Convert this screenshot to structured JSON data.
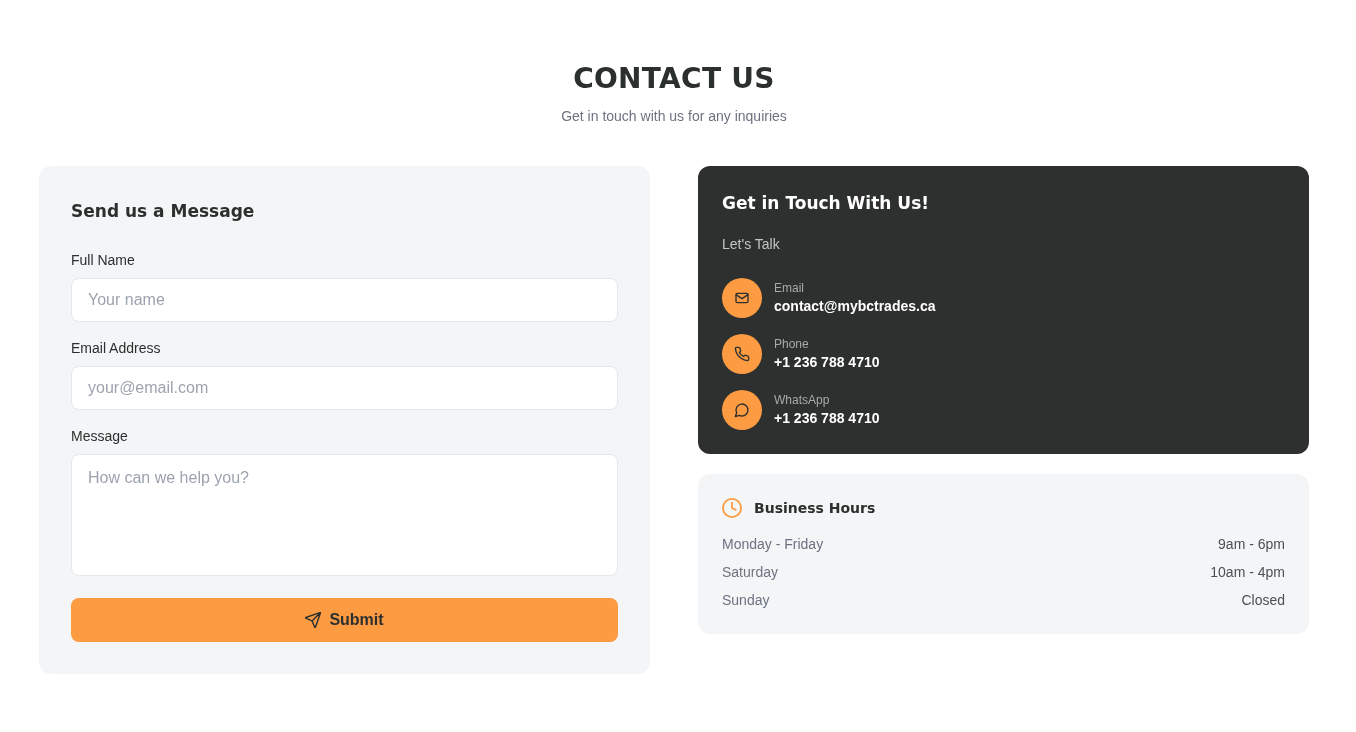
{
  "header": {
    "title": "CONTACT US",
    "subtitle": "Get in touch with us for any inquiries"
  },
  "form": {
    "title": "Send us a Message",
    "fields": [
      {
        "kind": "text",
        "label": "Full Name",
        "placeholder": "Your name"
      },
      {
        "kind": "email",
        "label": "Email Address",
        "placeholder": "your@email.com"
      },
      {
        "kind": "textarea",
        "label": "Message",
        "placeholder": "How can we help you?"
      }
    ],
    "submit_button": "Submit"
  },
  "contact_card": {
    "title": "Get in Touch With Us!",
    "subtitle": "Let's Talk",
    "items": [
      {
        "kind": "email",
        "label": "Email",
        "value": "contact@mybctrades.ca"
      },
      {
        "kind": "phone",
        "label": "Phone",
        "value": "+1 236 788 4710"
      },
      {
        "kind": "whatsapp",
        "label": "WhatsApp",
        "value": "+1 236 788 4710"
      }
    ]
  },
  "business_hours": {
    "title": "Business Hours",
    "rows": [
      {
        "day": "Monday - Friday",
        "hours": "9am - 6pm"
      },
      {
        "day": "Saturday",
        "hours": "10am - 4pm"
      },
      {
        "day": "Sunday",
        "hours": "Closed"
      }
    ]
  }
}
